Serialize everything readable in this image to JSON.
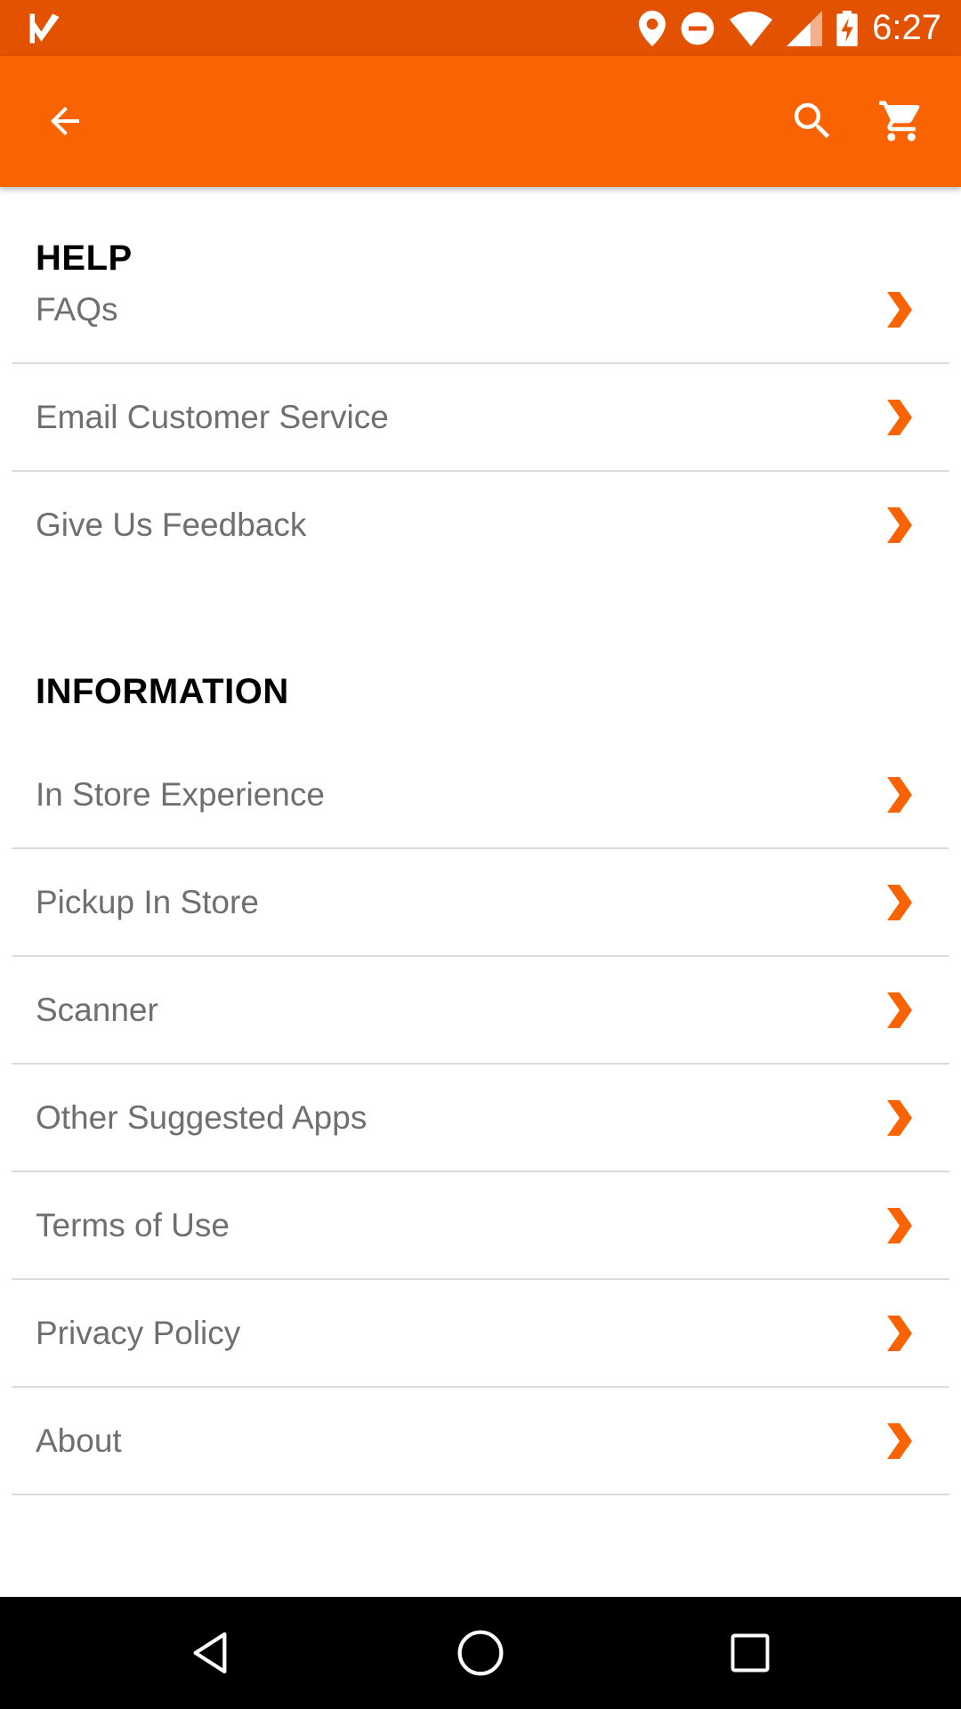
{
  "status_bar": {
    "time": "6:27",
    "icons": [
      "check-flag-icon",
      "location-icon",
      "do-not-disturb-icon",
      "wifi-icon",
      "signal-icon",
      "battery-charging-icon"
    ]
  },
  "app_bar": {
    "color": "#f96302",
    "back_icon": "arrow-back-icon",
    "search_icon": "search-icon",
    "cart_icon": "shopping-cart-icon"
  },
  "sections": [
    {
      "title": "HELP",
      "items": [
        "FAQs",
        "Email Customer Service",
        "Give Us Feedback"
      ]
    },
    {
      "title": "INFORMATION",
      "items": [
        "In Store Experience",
        "Pickup In Store",
        "Scanner",
        "Other Suggested Apps",
        "Terms of Use",
        "Privacy Policy",
        "About"
      ]
    }
  ],
  "accent_color": "#f96302",
  "nav_bar": {
    "back_icon": "nav-back-icon",
    "home_icon": "nav-home-icon",
    "recents_icon": "nav-recents-icon"
  }
}
